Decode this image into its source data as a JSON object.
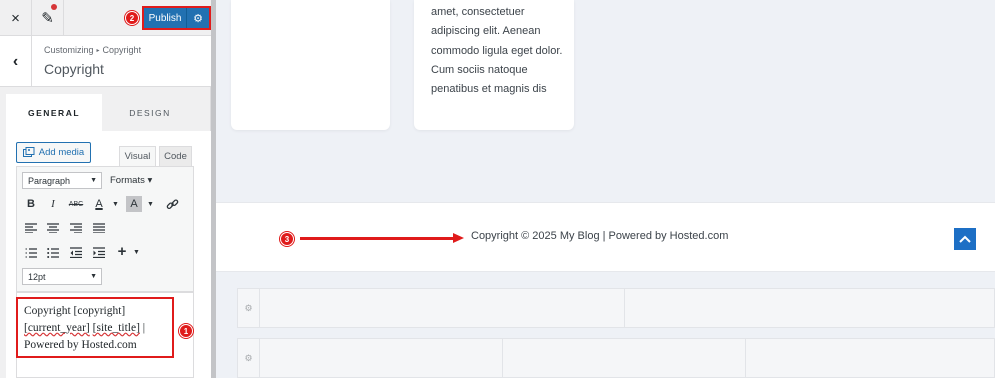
{
  "topbar": {
    "close_icon": "×",
    "edit_icon": "✎",
    "publish_label": "Publish",
    "publish_settings_icon": "⚙"
  },
  "section": {
    "breadcrumb_root": "Customizing",
    "breadcrumb_separator": "▸",
    "breadcrumb_current": "Copyright",
    "title": "Copyright",
    "back_icon": "‹"
  },
  "tabs": [
    {
      "label": "GENERAL",
      "active": true
    },
    {
      "label": "DESIGN",
      "active": false
    }
  ],
  "editor": {
    "add_media_label": "Add media",
    "mode_visual": "Visual",
    "mode_code": "Code",
    "block_format": "Paragraph",
    "formats_label": "Formats ▾",
    "font_size": "12pt",
    "content_line1": "Copyright [copyright]",
    "content_line2_a": "[current_year]",
    "content_line2_b": " ",
    "content_line2_c": "[site_title]",
    "content_line2_d": " |",
    "content_line3": "Powered by Hosted.com"
  },
  "markers": {
    "m1": "1",
    "m2": "2",
    "m3": "3"
  },
  "preview": {
    "card_text": "amet, consectetuer adipiscing elit. Aenean commodo ligula eget dolor. Cum sociis natoque penatibus et magnis dis",
    "footer_text": "Copyright © 2025 My Blog | Powered by Hosted.com",
    "to_top_icon": "^"
  },
  "colors": {
    "accent": "#2271b1",
    "annotation_red": "#e01b1b",
    "to_top_blue": "#1d6fc5"
  }
}
